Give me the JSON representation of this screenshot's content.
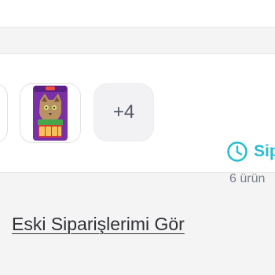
{
  "order": {
    "more_items_label": "+4",
    "status_label": "Sip",
    "item_count_label": "6 ürün"
  },
  "links": {
    "old_orders_label": "Eski Siparişlerimi Gör"
  },
  "icons": {
    "status": "clock-icon",
    "product": "product-image"
  },
  "colors": {
    "accent": "#24bfd0",
    "background": "#f4f4f5",
    "product_purple": "#7b2fa6",
    "product_red": "#d83b2b",
    "product_green": "#4d8f45"
  }
}
